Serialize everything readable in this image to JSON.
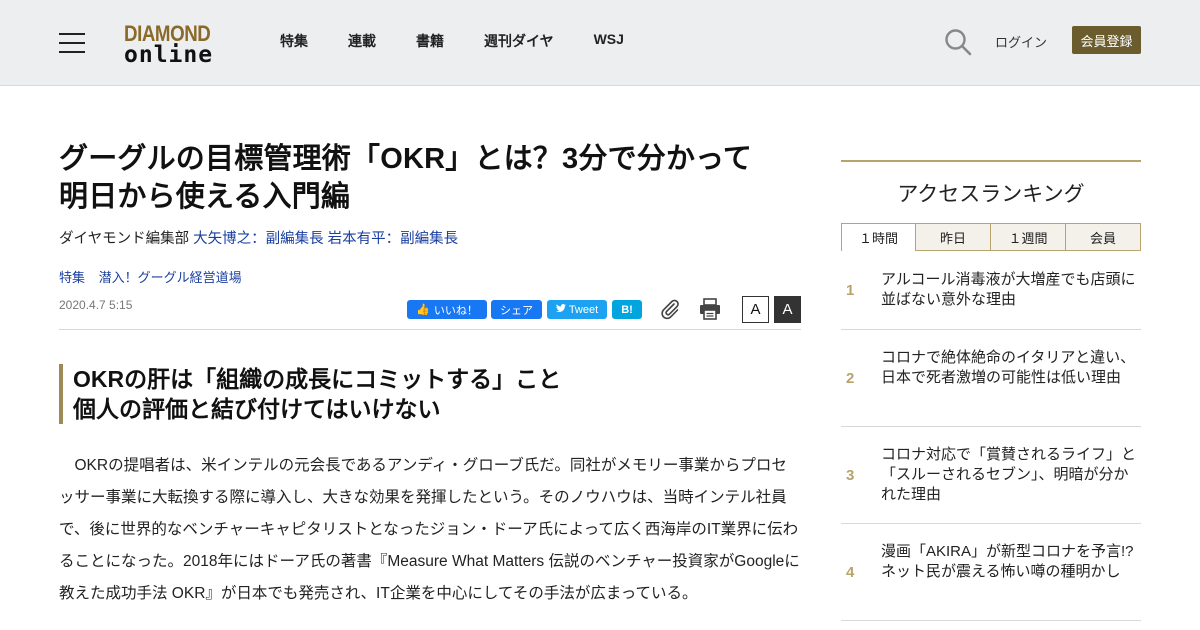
{
  "header": {
    "logo_top": "DIAMOND",
    "logo_bottom": "online",
    "nav": [
      "特集",
      "連載",
      "書籍",
      "週刊ダイヤ",
      "WSJ"
    ],
    "login": "ログイン",
    "register": "会員登録"
  },
  "article": {
    "title_line1": "グーグルの目標管理術「OKR」とは？3分で分かって",
    "title_line2": "明日から使える入門編",
    "author_prefix": "ダイヤモンド編集部",
    "author1": "大矢博之：副編集長",
    "author2": "岩本有平：副編集長",
    "tag1": "特集",
    "tag2": "潜入！グーグル経営道場",
    "date": "2020.4.7 5:15",
    "share": {
      "like": "いいね！",
      "share": "シェア",
      "tweet": "Tweet",
      "hatena": "B!"
    },
    "font_small": "A",
    "font_large": "A",
    "subhead_line1": "OKRの肝は「組織の成長にコミットする」こと",
    "subhead_line2": "個人の評価と結び付けてはいけない",
    "body": "OKRの提唱者は、米インテルの元会長であるアンディ・グローブ氏だ。同社がメモリー事業からプロセッサー事業に大転換する際に導入し、大きな効果を発揮したという。そのノウハウは、当時インテル社員で、後に世界的なベンチャーキャピタリストとなったジョン・ドーア氏によって広く西海岸のIT業界に伝わることになった。2018年にはドーア氏の著書『Measure What Matters 伝説のベンチャー投資家がGoogleに教えた成功手法 OKR』が日本でも発売され、IT企業を中心にしてその手法が広まっている。"
  },
  "sidebar": {
    "title": "アクセスランキング",
    "tabs": [
      "１時間",
      "昨日",
      "１週間",
      "会員"
    ],
    "items": [
      {
        "rank": "1",
        "text": "アルコール消毒液が大増産でも店頭に並ばない意外な理由"
      },
      {
        "rank": "2",
        "text": "コロナで絶体絶命のイタリアと違い、日本で死者激増の可能性は低い理由"
      },
      {
        "rank": "3",
        "text": "コロナ対応で「賞賛されるライフ」と「スルーされるセブン」、明暗が分かれた理由"
      },
      {
        "rank": "4",
        "text": "漫画「AKIRA」が新型コロナを予言!?ネット民が震える怖い噂の種明かし"
      }
    ]
  },
  "colors": {
    "accent_gold": "#b8a36a",
    "register_bg": "#6b5c2e",
    "link_blue": "#1a3fa0"
  }
}
